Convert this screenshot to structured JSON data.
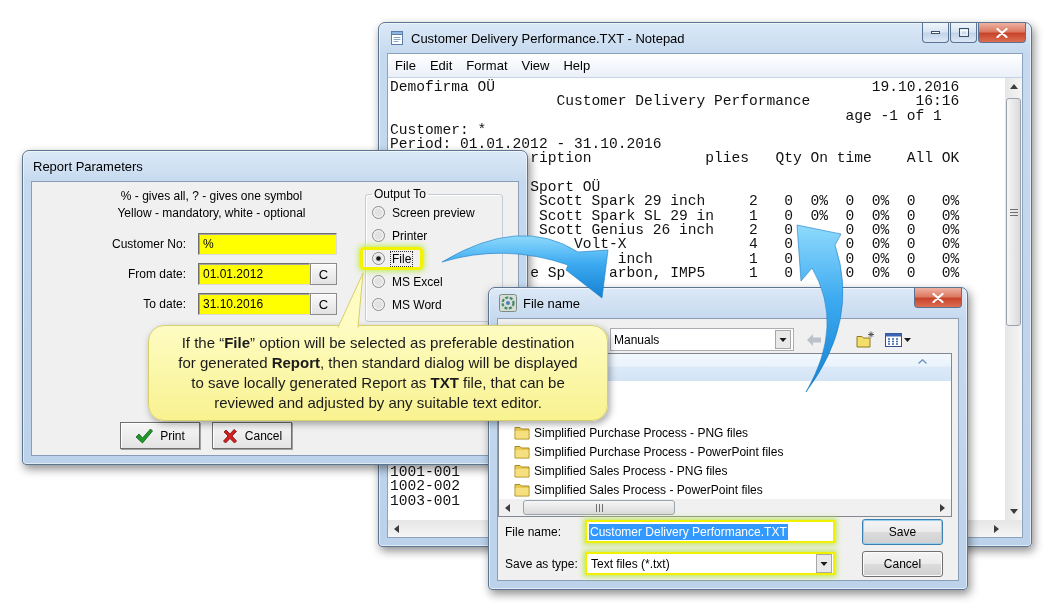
{
  "notepad": {
    "title": "Customer Delivery Performance.TXT - Notepad",
    "menu": [
      "File",
      "Edit",
      "Format",
      "View",
      "Help"
    ],
    "report_lines": [
      "Demofirma OÜ                                           19.10.2016",
      "                   Customer Delivery Performance            16:16",
      "                                                    age -1 of 1",
      "Customer: *",
      "Period: 01.01.2012 - 31.10.2016",
      "                ription             plies   Qty On time    All OK"
    ],
    "detail_lines": [
      "                Sport OÜ",
      "                 Scott Spark 29 inch     2   0  0%  0  0%  0   0%",
      "                 Scott Spark SL 29 in    1   0  0%  0  0%  0   0%",
      "                 Scott Genius 26 inch    2   0      0  0%  0   0%",
      "                     Volt-X              4   0      0  0%  0   0%",
      "                          inch           1   0      0  0%  0   0%",
      "                e Sp     arbon, IMP5     1   0      0  0%  0   0%"
    ],
    "code_lines": [
      "1001-001",
      "1002-002",
      "1003-001"
    ]
  },
  "report_parameters": {
    "title": "Report Parameters",
    "hints": [
      "% - gives all, ? - gives one symbol",
      "Yellow - mandatory, white - optional"
    ],
    "fields": [
      {
        "label": "Customer No:",
        "value": "%",
        "mandatory": true
      },
      {
        "label": "From date:",
        "value": "01.01.2012",
        "mandatory": true,
        "button": "C"
      },
      {
        "label": "To date:",
        "value": "31.10.2016",
        "mandatory": true,
        "button": "C"
      }
    ],
    "output": {
      "legend": "Output To",
      "options": [
        {
          "label": "Screen preview",
          "selected": false,
          "highlighted": false
        },
        {
          "label": "Printer",
          "selected": false,
          "highlighted": false
        },
        {
          "label": "File",
          "selected": true,
          "highlighted": true
        },
        {
          "label": "MS Excel",
          "selected": false,
          "highlighted": false
        },
        {
          "label": "MS Word",
          "selected": false,
          "highlighted": false
        }
      ]
    },
    "buttons": [
      {
        "label": "Print",
        "kind": "print"
      },
      {
        "label": "Cancel",
        "kind": "cancel"
      }
    ]
  },
  "callout": {
    "text": "If the “**File**” option will be selected as preferable destination for generated **Report**, then standard dialog will be displayed to save locally generated Report as **TXT** file, that can be reviewed and adjusted by any suitable text editor."
  },
  "file_dialog": {
    "title": "File name",
    "location": "Manuals",
    "items": [
      "Simplified Purchase Process - PNG files",
      "Simplified Purchase Process - PowerPoint files",
      "Simplified Sales Process - PNG files",
      "Simplified Sales Process - PowerPoint files"
    ],
    "file_name": {
      "label": "File name:",
      "value": "Customer Delivery Performance.TXT",
      "text_selected": true,
      "highlighted": true
    },
    "file_type": {
      "label": "Save as type:",
      "value": "Text files (*.txt)",
      "highlighted": true
    },
    "buttons": [
      {
        "label": "Save",
        "default": true
      },
      {
        "label": "Cancel",
        "default": false
      }
    ]
  }
}
